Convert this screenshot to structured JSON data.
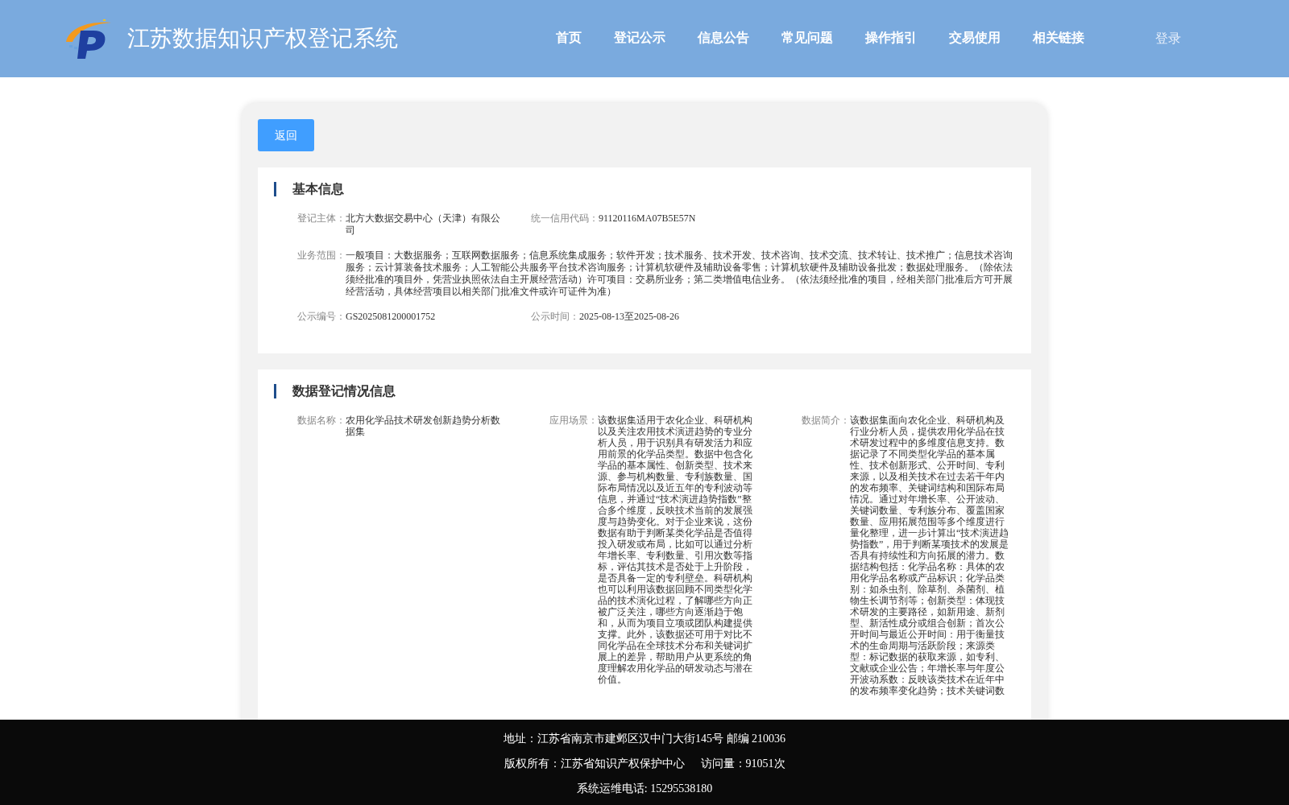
{
  "header": {
    "title": "江苏数据知识产权登记系统",
    "nav": [
      {
        "label": "首页",
        "selected": false
      },
      {
        "label": "登记公示",
        "selected": false
      },
      {
        "label": "信息公告",
        "selected": false
      },
      {
        "label": "常见问题",
        "selected": false
      },
      {
        "label": "操作指引",
        "selected": false
      },
      {
        "label": "交易使用",
        "selected": false
      },
      {
        "label": "相关链接",
        "selected": false
      }
    ],
    "login": "登录"
  },
  "back_button": "返回",
  "sections": [
    {
      "title": "基本信息",
      "rows": [
        [
          {
            "label": "登记主体：",
            "value": "北方大数据交易中心（天津）有限公司"
          },
          {
            "label": "统一信用代码：",
            "value": "91120116MA07B5E57N"
          }
        ],
        [
          {
            "label": "业务范围：",
            "value": "一般项目：大数据服务；互联网数据服务；信息系统集成服务；软件开发；技术服务、技术开发、技术咨询、技术交流、技术转让、技术推广；信息技术咨询服务；云计算装备技术服务；人工智能公共服务平台技术咨询服务；计算机软硬件及辅助设备零售；计算机软硬件及辅助设备批发；数据处理服务。（除依法须经批准的项目外，凭营业执照依法自主开展经营活动）许可项目：交易所业务；第二类增值电信业务。（依法须经批准的项目，经相关部门批准后方可开展经营活动，具体经营项目以相关部门批准文件或许可证件为准）"
          }
        ],
        [
          {
            "label": "公示编号：",
            "value": "GS2025081200001752"
          },
          {
            "label": "公示时间：",
            "value": "2025-08-13至2025-08-26"
          }
        ]
      ]
    },
    {
      "title": "数据登记情况信息",
      "rows": [
        [
          {
            "label": "数据名称：",
            "value": "农用化学品技术研发创新趋势分析数据集"
          },
          {
            "label": "应用场景：",
            "value": "该数据集适用于农化企业、科研机构以及关注农用技术演进趋势的专业分析人员，用于识别具有研发活力和应用前景的化学品类型。数据中包含化学品的基本属性、创新类型、技术来源、参与机构数量、专利族数量、国际布局情况以及近五年的专利波动等信息，并通过“技术演进趋势指数”整合多个维度，反映技术当前的发展强度与趋势变化。对于企业来说，这份数据有助于判断某类化学品是否值得投入研发或布局，比如可以通过分析年增长率、专利数量、引用次数等指标，评估其技术是否处于上升阶段，是否具备一定的专利壁垒。科研机构也可以利用该数据回顾不同类型化学品的技术演化过程，了解哪些方向正被广泛关注，哪些方向逐渐趋于饱和，从而为项目立项或团队构建提供支撑。此外，该数据还可用于对比不同化学品在全球技术分布和关键词扩展上的差异，帮助用户从更系统的角度理解农用化学品的研发动态与潜在价值。"
          },
          {
            "label": "数据简介：",
            "value": "该数据集面向农化企业、科研机构及行业分析人员，提供农用化学品在技术研发过程中的多维度信息支持。数据记录了不同类型化学品的基本属性、技术创新形式、公开时间、专利来源，以及相关技术在过去若干年内的发布频率、关键词结构和国际布局情况。通过对年增长率、公开波动、关键词数量、专利族分布、覆盖国家数量、应用拓展范围等多个维度进行量化整理，进一步计算出“技术演进趋势指数”，用于判断某项技术的发展是否具有持续性和方向拓展的潜力。数据结构包括：化学品名称：具体的农用化学品名称或产品标识；化学品类别：如杀虫剂、除草剂、杀菌剂、植物生长调节剂等；创新类型：体现技术研发的主要路径，如新用途、新剂型、新活性成分或组合创新；首次公开时间与最近公开时间：用于衡量技术的生命周期与活跃阶段；来源类型：标记数据的获取来源，如专利、文献或企业公告；年增长率与年度公开波动系数：反映该类技术在近年中的发布频率变化趋势；技术关键词数"
          }
        ]
      ]
    }
  ],
  "footer": {
    "lines": [
      [
        "地址：江苏省南京市建邺区汉中门大街145号 邮编 210036"
      ],
      [
        "版权所有：江苏省知识产权保护中心",
        "访问量：91051次"
      ],
      [
        "系统运维电话: 15295538180"
      ]
    ]
  }
}
